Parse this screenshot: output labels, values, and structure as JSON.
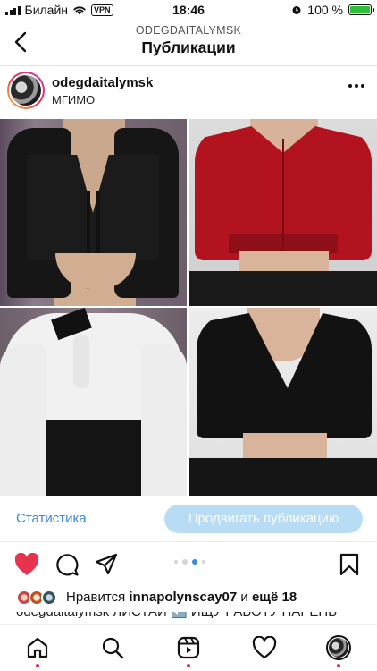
{
  "status_bar": {
    "carrier": "Билайн",
    "vpn_label": "VPN",
    "time": "18:46",
    "battery_percent": "100 %",
    "battery_level": 1.0
  },
  "header": {
    "subtitle": "ODEGDAITALYMSK",
    "title": "Публикации"
  },
  "post": {
    "username": "odegdaitalymsk",
    "location": "МГИМО",
    "carousel_index": 3,
    "carousel_count": 4
  },
  "actions": {
    "stats_label": "Статистика",
    "promote_label": "Продвигать публикацию"
  },
  "likes": {
    "prefix": "Нравится ",
    "user": "innapolynscay07",
    "middle": " и ",
    "rest": "ещё 18"
  },
  "caption": {
    "text": "odegdaitalymsk ЛИСТАЙ ⬅️ ИЩУ РАБОТУ ПАРЕНЬ"
  },
  "icons": {
    "back": "chevron-left-icon",
    "more": "more-horizontal-icon",
    "like": "heart-filled-icon",
    "comment": "comment-icon",
    "share": "send-icon",
    "save": "bookmark-icon",
    "home": "home-icon",
    "search": "search-icon",
    "reels": "reels-icon",
    "activity": "heart-outline-icon"
  },
  "colors": {
    "accent": "#3a8ad8",
    "promote_bg": "#b9dcf5",
    "like_red": "#e8334e",
    "battery": "#2fbf3a"
  }
}
